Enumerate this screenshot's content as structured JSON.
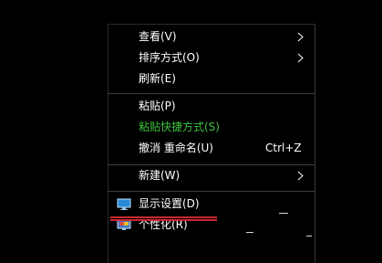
{
  "context_menu": {
    "items": [
      {
        "label": "查看(V)",
        "submenu": true
      },
      {
        "label": "排序方式(O)",
        "submenu": true
      },
      {
        "label": "刷新(E)"
      },
      {
        "label": "粘贴(P)"
      },
      {
        "label": "粘贴快捷方式(S)",
        "disabled_color": "#3ec23e"
      },
      {
        "label": "撤消 重命名(U)",
        "shortcut": "Ctrl+Z"
      },
      {
        "label": "新建(W)",
        "submenu": true
      },
      {
        "label": "显示设置(D)",
        "icon": "display-settings-icon"
      },
      {
        "label": "个性化(R)",
        "icon": "personalize-icon"
      }
    ]
  },
  "colors": {
    "background": "#000000",
    "text": "#ffffff",
    "paste_shortcut_text": "#3ec23e",
    "annotation_red": "#c8282e"
  }
}
